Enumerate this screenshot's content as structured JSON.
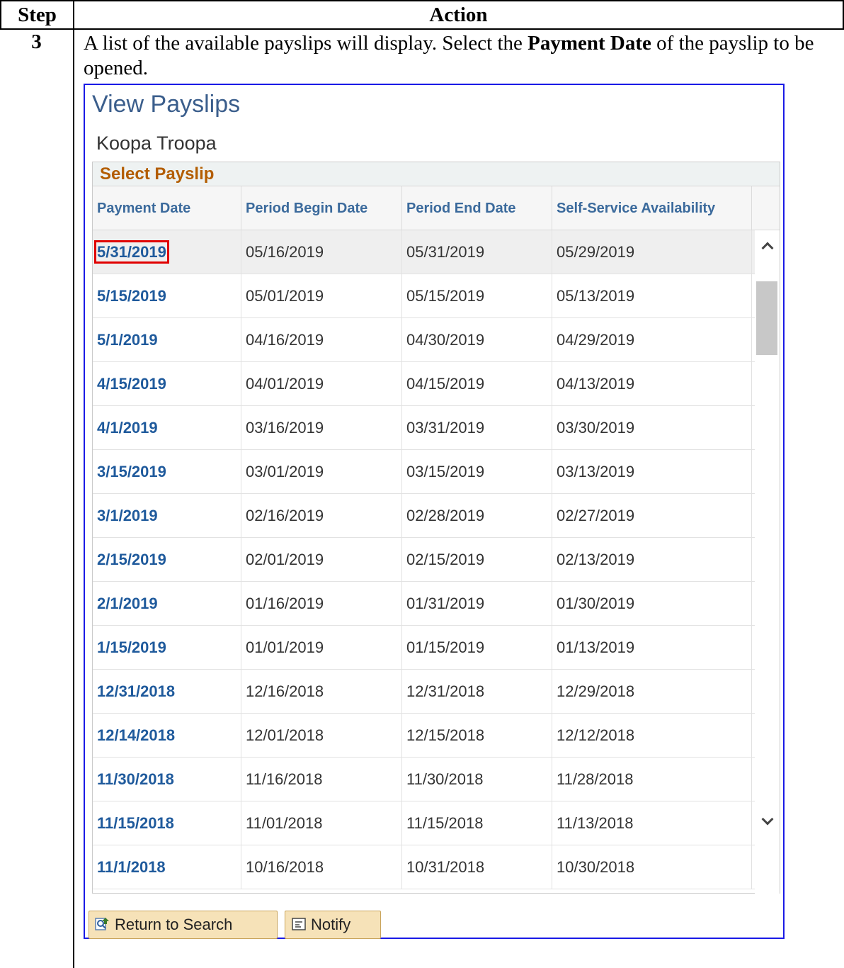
{
  "doc": {
    "step_header": "Step",
    "action_header": "Action",
    "step_number": "3",
    "instruction_pre": "A list of the available payslips will display.  Select the ",
    "instruction_bold": "Payment Date",
    "instruction_post": " of the payslip to be opened."
  },
  "panel": {
    "title": "View Payslips",
    "employee_name": "Koopa Troopa",
    "grid_caption": "Select Payslip",
    "columns": [
      "Payment Date",
      "Period Begin Date",
      "Period End Date",
      "Self-Service Availability"
    ],
    "rows": [
      [
        "5/31/2019",
        "05/16/2019",
        "05/31/2019",
        "05/29/2019"
      ],
      [
        "5/15/2019",
        "05/01/2019",
        "05/15/2019",
        "05/13/2019"
      ],
      [
        "5/1/2019",
        "04/16/2019",
        "04/30/2019",
        "04/29/2019"
      ],
      [
        "4/15/2019",
        "04/01/2019",
        "04/15/2019",
        "04/13/2019"
      ],
      [
        "4/1/2019",
        "03/16/2019",
        "03/31/2019",
        "03/30/2019"
      ],
      [
        "3/15/2019",
        "03/01/2019",
        "03/15/2019",
        "03/13/2019"
      ],
      [
        "3/1/2019",
        "02/16/2019",
        "02/28/2019",
        "02/27/2019"
      ],
      [
        "2/15/2019",
        "02/01/2019",
        "02/15/2019",
        "02/13/2019"
      ],
      [
        "2/1/2019",
        "01/16/2019",
        "01/31/2019",
        "01/30/2019"
      ],
      [
        "1/15/2019",
        "01/01/2019",
        "01/15/2019",
        "01/13/2019"
      ],
      [
        "12/31/2018",
        "12/16/2018",
        "12/31/2018",
        "12/29/2018"
      ],
      [
        "12/14/2018",
        "12/01/2018",
        "12/15/2018",
        "12/12/2018"
      ],
      [
        "11/30/2018",
        "11/16/2018",
        "11/30/2018",
        "11/28/2018"
      ],
      [
        "11/15/2018",
        "11/01/2018",
        "11/15/2018",
        "11/13/2018"
      ],
      [
        "11/1/2018",
        "10/16/2018",
        "10/31/2018",
        "10/30/2018"
      ]
    ],
    "highlighted_row": 0,
    "buttons": {
      "return_label": "Return to Search",
      "notify_label": "Notify"
    }
  },
  "colors": {
    "link": "#1f5a9c",
    "caption": "#b35d00",
    "button_bg": "#f6e2b8",
    "highlight": "#e00000",
    "panel_border": "#1a1ae6"
  },
  "icons": {
    "return": "search-return-icon",
    "notify": "notify-icon",
    "scroll_up": "chevron-up-icon",
    "scroll_down": "chevron-down-icon"
  }
}
